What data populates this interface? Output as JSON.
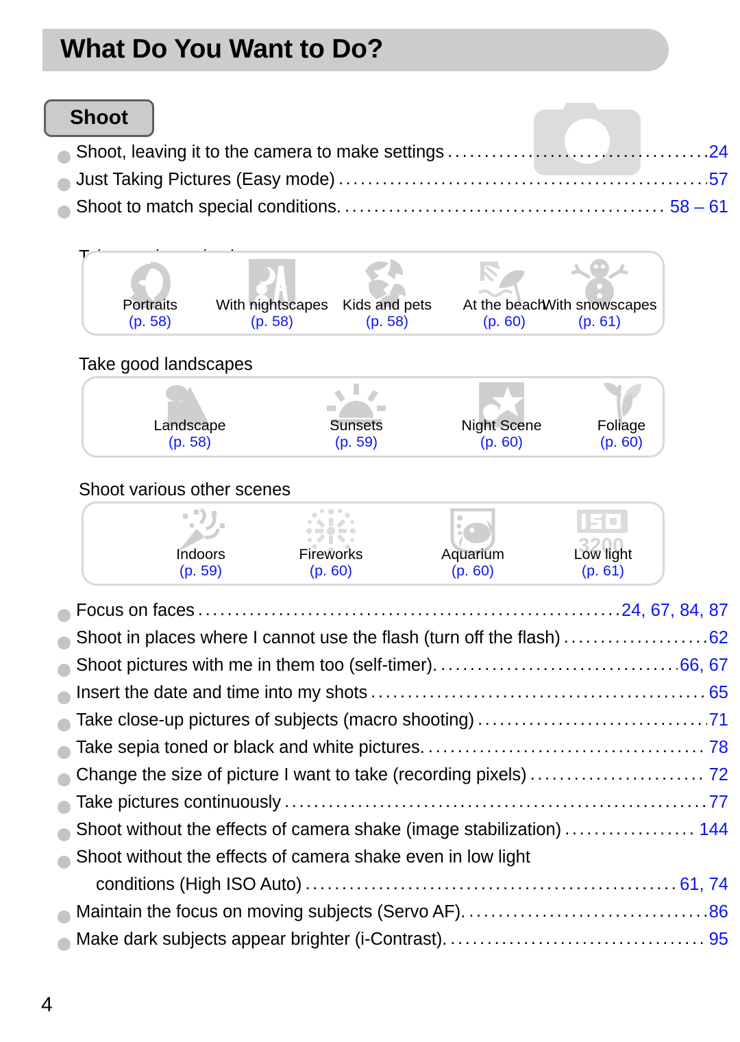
{
  "header": {
    "title": "What Do You Want to Do?"
  },
  "section": {
    "badge_label": "Shoot"
  },
  "watermark": {
    "icon": "camera-icon"
  },
  "top_list": [
    {
      "text": "Shoot, leaving it to the camera to make settings",
      "page": "24"
    },
    {
      "text": "Just Taking Pictures (Easy mode)",
      "page": "57"
    },
    {
      "text": "Shoot to match special conditions.",
      "page": "58 – 61"
    }
  ],
  "groups": [
    {
      "heading": "Take good people shots",
      "items": [
        {
          "icon": "portrait-icon",
          "label": "Portraits",
          "page": "(p. 58)"
        },
        {
          "icon": "nightscape-icon",
          "label": "With nightscapes",
          "page": "(p. 58)"
        },
        {
          "icon": "kids-pets-icon",
          "label": "Kids and pets",
          "page": "(p. 58)"
        },
        {
          "icon": "beach-icon",
          "label": "At the beach",
          "page": "(p. 60)"
        },
        {
          "icon": "snow-icon",
          "label": "With snowscapes",
          "page": "(p. 61)"
        }
      ]
    },
    {
      "heading": "Take good landscapes",
      "items": [
        {
          "icon": "landscape-icon",
          "label": "Landscape",
          "page": "(p. 58)"
        },
        {
          "icon": "sunset-icon",
          "label": "Sunsets",
          "page": "(p. 59)"
        },
        {
          "icon": "night-scene-icon",
          "label": "Night Scene",
          "page": "(p. 60)"
        },
        {
          "icon": "foliage-icon",
          "label": "Foliage",
          "page": "(p. 60)"
        }
      ]
    },
    {
      "heading": "Shoot various other scenes",
      "items": [
        {
          "icon": "indoors-icon",
          "label": "Indoors",
          "page": "(p. 59)"
        },
        {
          "icon": "fireworks-icon",
          "label": "Fireworks",
          "page": "(p. 60)"
        },
        {
          "icon": "aquarium-icon",
          "label": "Aquarium",
          "page": "(p. 60)"
        },
        {
          "icon": "iso-3200-icon",
          "label": "Low light",
          "page": "(p. 61)"
        }
      ]
    }
  ],
  "bottom_list": [
    {
      "text": "Focus on faces",
      "page": "24, 67, 84, 87"
    },
    {
      "text": "Shoot in places where I cannot use the flash (turn off the flash)",
      "page": "62"
    },
    {
      "text": "Shoot pictures with me in them too (self-timer).",
      "page": "66, 67"
    },
    {
      "text": "Insert the date and time into my shots",
      "page": "65"
    },
    {
      "text": "Take close-up pictures of subjects (macro shooting)",
      "page": "71"
    },
    {
      "text": "Take sepia toned or black and white pictures.",
      "page": "78"
    },
    {
      "text": "Change the size of picture I want to take (recording pixels)",
      "page": "72"
    },
    {
      "text": "Take pictures continuously",
      "page": "77"
    },
    {
      "text": "Shoot without the effects of camera shake (image stabilization)",
      "page": "144"
    },
    {
      "text": "Shoot without the effects of camera shake even in low light",
      "page": "",
      "wrap": true
    },
    {
      "text": "conditions (High ISO Auto)",
      "page": "61, 74",
      "cont": true
    },
    {
      "text": "Maintain the focus on moving subjects (Servo AF).",
      "page": "86"
    },
    {
      "text": "Make dark subjects appear brighter (i-Contrast).",
      "page": "95"
    }
  ],
  "folio": "4",
  "colors": {
    "header_bg": "#cccccc",
    "badge_bg": "#cbcbcb",
    "badge_border": "#5e5e5e",
    "link_blue": "#0b15f0",
    "icon_gray": "#cfcfcf",
    "bullet_gray": "#c4c4c4",
    "panel_border": "#d8d8d8"
  }
}
